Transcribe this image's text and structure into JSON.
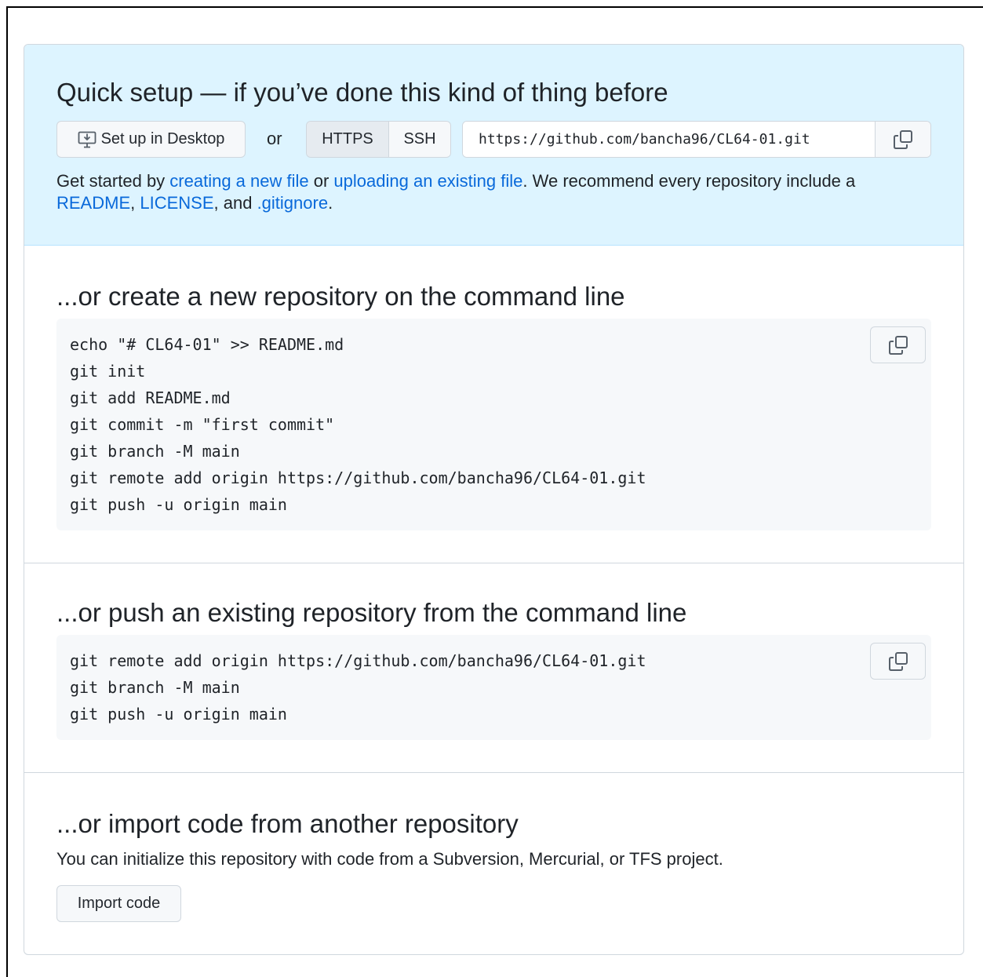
{
  "quick_setup": {
    "title": "Quick setup — if you’ve done this kind of thing before",
    "desktop_button": "Set up in Desktop",
    "or_label": "or",
    "protocols": [
      "HTTPS",
      "SSH"
    ],
    "selected_protocol": "HTTPS",
    "clone_url": "https://github.com/bancha96/CL64-01.git",
    "intro": {
      "prefix": "Get started by ",
      "link_new_file": "creating a new file",
      "mid": " or ",
      "link_upload": "uploading an existing file",
      "suffix": ". We recommend every repository include a ",
      "link_readme": "README",
      "sep1": ", ",
      "link_license": "LICENSE",
      "sep2": ", and ",
      "link_gitignore": ".gitignore",
      "end": "."
    }
  },
  "create_section": {
    "title": "...or create a new repository on the command line",
    "code": "echo \"# CL64-01\" >> README.md\ngit init\ngit add README.md\ngit commit -m \"first commit\"\ngit branch -M main\ngit remote add origin https://github.com/bancha96/CL64-01.git\ngit push -u origin main"
  },
  "push_section": {
    "title": "...or push an existing repository from the command line",
    "code": "git remote add origin https://github.com/bancha96/CL64-01.git\ngit branch -M main\ngit push -u origin main"
  },
  "import_section": {
    "title": "...or import code from another repository",
    "description": "You can initialize this repository with code from a Subversion, Mercurial, or TFS project.",
    "button": "Import code"
  },
  "colors": {
    "link": "#0969da",
    "quick_setup_bg": "#ddf4ff",
    "code_bg": "#f6f8fa",
    "border": "#d0d7de"
  },
  "icons": {
    "desktop": "desktop-download-icon",
    "copy": "copy-icon"
  }
}
